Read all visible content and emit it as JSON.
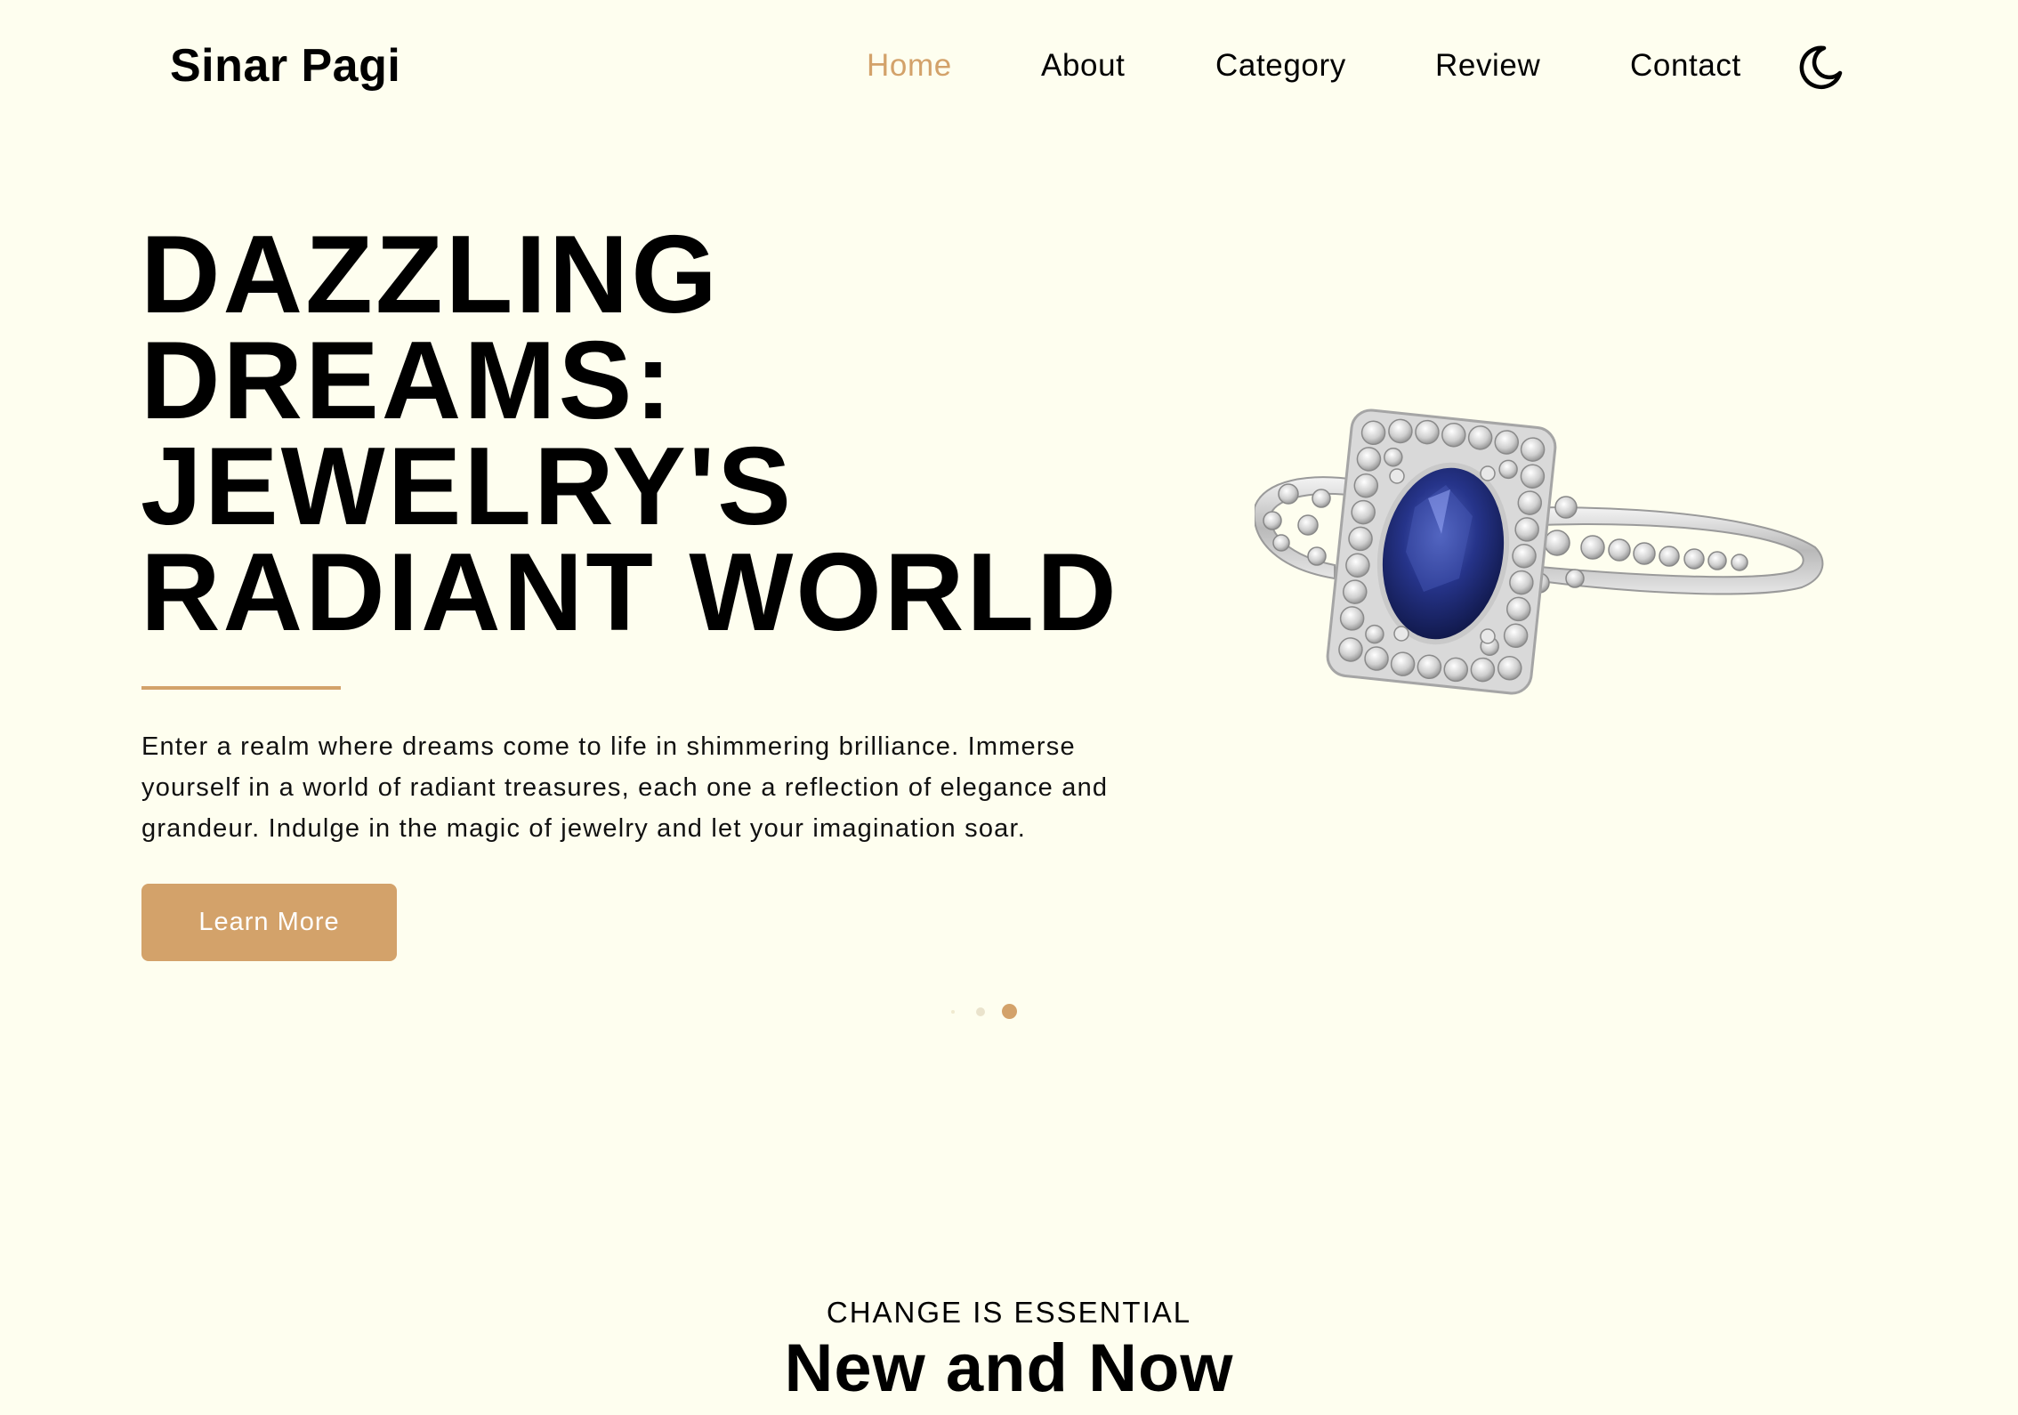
{
  "brand": {
    "name": "Sinar Pagi"
  },
  "nav": {
    "items": [
      {
        "label": "Home",
        "active": true
      },
      {
        "label": "About",
        "active": false
      },
      {
        "label": "Category",
        "active": false
      },
      {
        "label": "Review",
        "active": false
      },
      {
        "label": "Contact",
        "active": false
      }
    ],
    "theme_toggle_icon": "moon-icon"
  },
  "hero": {
    "title_lines": [
      "DAZZLING",
      "DREAMS:",
      "JEWELRY'S",
      "RADIANT WORLD"
    ],
    "description": "Enter a realm where dreams come to life in shimmering brilliance. Immerse yourself in a world of radiant treasures, each one a reflection of elegance and grandeur. Indulge in the magic of jewelry and let your imagination soar.",
    "cta_label": "Learn More",
    "image_icon": "sapphire-ring-image"
  },
  "carousel": {
    "slide_count": 3,
    "active_index": 2
  },
  "section": {
    "eyebrow": "CHANGE IS ESSENTIAL",
    "title": "New and Now"
  },
  "colors": {
    "background": "#fefeef",
    "accent": "#d3a26a",
    "text": "#000000"
  }
}
